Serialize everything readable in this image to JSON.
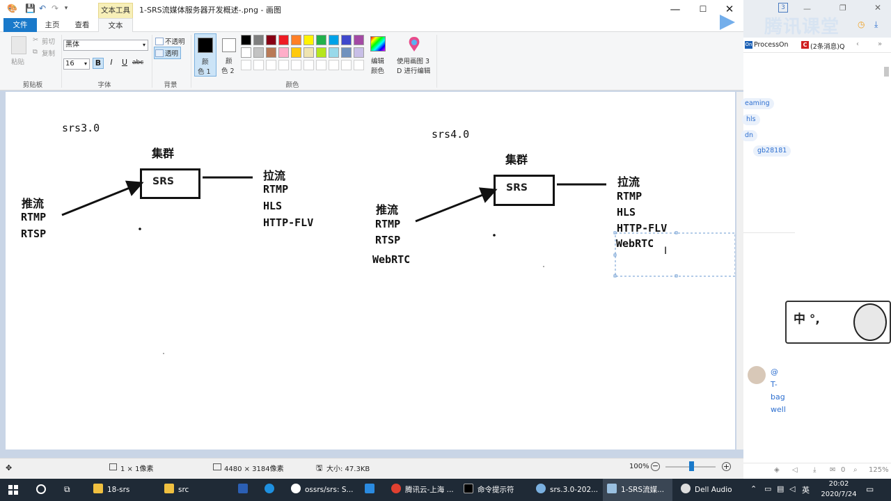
{
  "paint": {
    "title": "1-SRS流媒体服务器开发概述-.png - 画图",
    "context_tab": "文本工具",
    "tabs": [
      "文件",
      "主页",
      "查看",
      "文本"
    ],
    "clipboard": {
      "paste": "粘贴",
      "cut": "剪切",
      "copy": "复制",
      "group": "剪贴板"
    },
    "font": {
      "family": "黑体",
      "size": "16",
      "bold": "B",
      "italic": "I",
      "underline": "U",
      "strike": "abc",
      "group": "字体"
    },
    "background": {
      "opaque": "不透明",
      "transparent": "透明",
      "group": "背景"
    },
    "colors": {
      "color1": "颜\n色 1",
      "color1_a": "颜",
      "color1_b": "色 1",
      "color2_a": "颜",
      "color2_b": "色 2",
      "edit_a": "编辑",
      "edit_b": "颜色",
      "paint3d_a": "使用画图 3",
      "paint3d_b": "D 进行编辑",
      "group": "颜色",
      "palette_row1": [
        "#000000",
        "#7f7f7f",
        "#880015",
        "#ed1c24",
        "#ff7f27",
        "#fff200",
        "#22b14c",
        "#00a2e8",
        "#3f48cc",
        "#a349a4"
      ],
      "palette_row2": [
        "#ffffff",
        "#c3c3c3",
        "#b97a57",
        "#ffaec9",
        "#ffc90e",
        "#efe4b0",
        "#b5e61d",
        "#99d9ea",
        "#7092be",
        "#c8bfe7"
      ]
    },
    "canvas": {
      "left": {
        "version": "srs3.0",
        "cluster": "集群",
        "box": "SRS",
        "pull_title": "拉流",
        "pull": [
          "RTMP",
          "HLS",
          "HTTP-FLV"
        ],
        "push_title": "推流",
        "push": [
          "RTMP",
          "RTSP"
        ]
      },
      "right": {
        "version": "srs4.0",
        "cluster": "集群",
        "box": "SRS",
        "pull_title": "拉流",
        "pull": [
          "RTMP",
          "HLS",
          "HTTP-FLV",
          "WebRTC"
        ],
        "push_title": "推流",
        "push": [
          "RTMP",
          "RTSP",
          "WebRTC"
        ]
      }
    },
    "status": {
      "selection": "1 × 1像素",
      "dimensions": "4480 × 3184像素",
      "size": "大小: 47.3KB",
      "zoom": "100%"
    }
  },
  "right_app": {
    "brand": "腾讯课堂",
    "badge": "3",
    "bookmarks": [
      "ProcessOn",
      "(2条消息)Q"
    ],
    "chips": [
      "eaming",
      "hls",
      "dn",
      "gb28181"
    ],
    "ime_text": "中 °,",
    "user_alt": [
      "@",
      "T-",
      "bag",
      "well"
    ],
    "bottom_zoom": "125%",
    "bottom_count": "0"
  },
  "taskbar": {
    "items": [
      "18-srs",
      "src",
      "",
      "",
      "ossrs/srs: S...",
      "",
      "腾讯云-上海 ...",
      "命令提示符",
      "srs.3.0-202...",
      "1-SRS流媒...",
      "Dell Audio"
    ],
    "time": "20:02",
    "date": "2020/7/24"
  }
}
